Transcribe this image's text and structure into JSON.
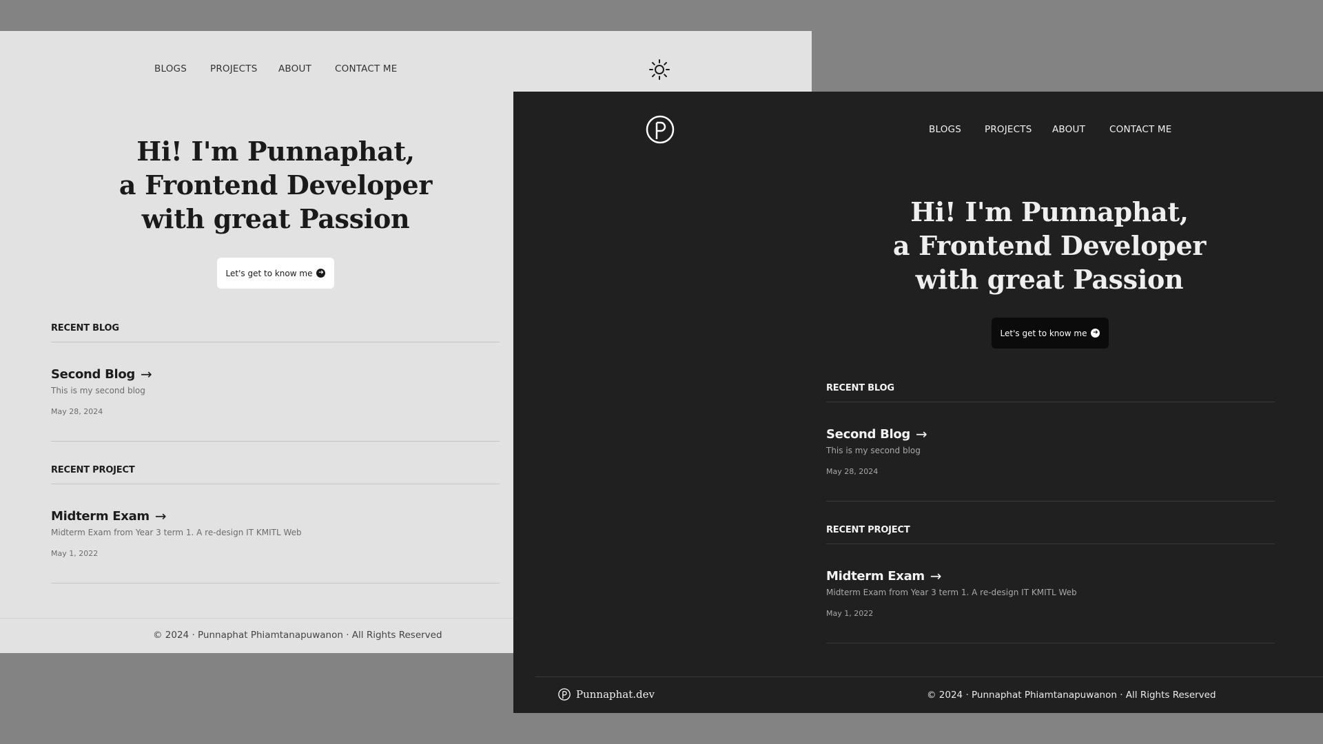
{
  "nav": {
    "blogs": "BLOGS",
    "projects": "PROJECTS",
    "about": "ABOUT",
    "contact": "CONTACT ME"
  },
  "hero": {
    "line1": "Hi! I'm Punnaphat,",
    "line2": "a Frontend Developer",
    "line3": "with great Passion",
    "cta_label": "Let's get to know me"
  },
  "recent_blog": {
    "label": "RECENT BLOG",
    "title": "Second Blog",
    "description": "This is my second blog",
    "date": "May 28, 2024"
  },
  "recent_project": {
    "label": "RECENT PROJECT",
    "title": "Midterm Exam",
    "description": "Midterm Exam from Year 3 term 1. A re-design IT KMITL Web",
    "date": "May 1, 2022"
  },
  "footer": {
    "copyright": "© 2024 · Punnaphat Phiamtanapuwanon · All Rights Reserved",
    "brand": "Punnaphat.dev"
  },
  "icons": {
    "logo": "p-logo-icon",
    "theme": "sun-icon",
    "cta": "arrow-right-circle-icon",
    "item": "arrow-right-icon"
  },
  "colors": {
    "light_bg": "#e2e2e2",
    "dark_bg": "#202020",
    "canvas_bg": "#838383"
  }
}
